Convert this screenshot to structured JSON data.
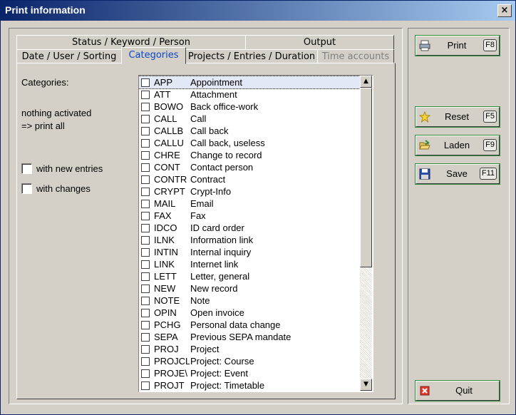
{
  "window": {
    "title": "Print information",
    "close": "×"
  },
  "tabs": {
    "row1": [
      "Status / Keyword / Person",
      "Output"
    ],
    "row2": [
      "Date / User / Sorting",
      "Categories",
      "Projects / Entries / Duration",
      "Time accounts"
    ],
    "active": "Categories"
  },
  "left": {
    "categories_label": "Categories:",
    "status_line1": "nothing activated",
    "status_line2": "=> print all",
    "with_new_entries": "with new entries",
    "with_changes": "with changes"
  },
  "list": {
    "items": [
      {
        "code": "APP",
        "desc": "Appointment"
      },
      {
        "code": "ATT",
        "desc": "Attachment"
      },
      {
        "code": "BOWO",
        "desc": "Back office-work"
      },
      {
        "code": "CALL",
        "desc": "Call"
      },
      {
        "code": "CALLB",
        "desc": "Call back"
      },
      {
        "code": "CALLU",
        "desc": "Call back, useless"
      },
      {
        "code": "CHRE",
        "desc": "Change to record"
      },
      {
        "code": "CONT",
        "desc": "Contact person"
      },
      {
        "code": "CONTR",
        "desc": "Contract"
      },
      {
        "code": "CRYPT",
        "desc": "Crypt-Info"
      },
      {
        "code": "MAIL",
        "desc": "Email"
      },
      {
        "code": "FAX",
        "desc": "Fax"
      },
      {
        "code": "IDCO",
        "desc": "ID card order"
      },
      {
        "code": "ILNK",
        "desc": "Information link"
      },
      {
        "code": "INTIN",
        "desc": "Internal inquiry"
      },
      {
        "code": "LINK",
        "desc": "Internet link"
      },
      {
        "code": "LETT",
        "desc": "Letter, general"
      },
      {
        "code": "NEW",
        "desc": "New record"
      },
      {
        "code": "NOTE",
        "desc": "Note"
      },
      {
        "code": "OPIN",
        "desc": "Open invoice"
      },
      {
        "code": "PCHG",
        "desc": "Personal data change"
      },
      {
        "code": "SEPA",
        "desc": "Previous SEPA mandate"
      },
      {
        "code": "PROJ",
        "desc": "Project"
      },
      {
        "code": "PROJCL",
        "desc": "Project: Course"
      },
      {
        "code": "PROJE\\",
        "desc": "Project: Event"
      },
      {
        "code": "PROJT",
        "desc": "Project: Timetable"
      }
    ]
  },
  "buttons": {
    "print": {
      "label": "Print",
      "key": "F8"
    },
    "reset": {
      "label": "Reset",
      "key": "F5"
    },
    "laden": {
      "label": "Laden",
      "key": "F9"
    },
    "save": {
      "label": "Save",
      "key": "F11"
    },
    "quit": {
      "label": "Quit"
    }
  },
  "colors": {
    "accent": "#0a246a",
    "active_tab_text": "#0a48c8",
    "button_focus": "#2b8a3e"
  }
}
